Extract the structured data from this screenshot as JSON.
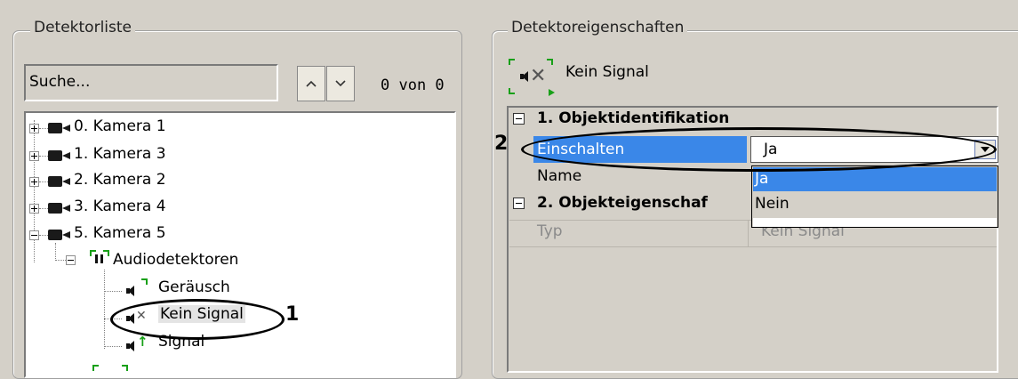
{
  "left_panel": {
    "title": "Detektorliste",
    "search": {
      "value": "Suche..."
    },
    "counter": "0 von 0",
    "tree": {
      "cameras": [
        "0. Kamera 1",
        "1. Kamera 3",
        "2. Kamera 2",
        "3. Kamera 4",
        "5. Kamera 5"
      ],
      "group": "Audiodetektoren",
      "detectors": [
        "Geräusch",
        "Kein Signal",
        "Signal"
      ]
    }
  },
  "right_panel": {
    "title": "Detektoreigenschaften",
    "header": "Kein Signal",
    "sections": [
      "1. Objektidentifikation",
      "2. Objekteigenschaf"
    ],
    "properties": {
      "einschalten": {
        "label": "Einschalten",
        "value": "Ja"
      },
      "name": {
        "label": "Name"
      },
      "typ": {
        "label": "Typ",
        "value": "Kein Signal"
      }
    },
    "dropdown_options": [
      "Ja",
      "Nein"
    ]
  },
  "annotations": {
    "label_1": "1",
    "label_2": "2"
  },
  "colors": {
    "selection": "#3a87e8",
    "window_bg": "#d4d0c8",
    "green_accent": "#18a018"
  }
}
